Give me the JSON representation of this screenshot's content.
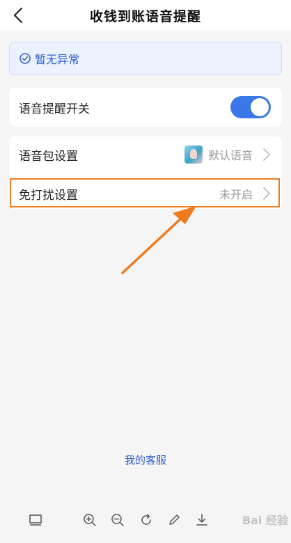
{
  "header": {
    "title": "收钱到账语音提醒"
  },
  "status": {
    "text": "暂无异常"
  },
  "voice_switch": {
    "label": "语音提醒开关",
    "on": true
  },
  "voice_pack": {
    "label": "语音包设置",
    "value": "默认语音"
  },
  "dnd": {
    "label": "免打扰设置",
    "value": "未开启"
  },
  "footer": {
    "service_link": "我的客服"
  },
  "toolbar": {
    "watermark": "Bai 经验"
  },
  "colors": {
    "accent": "#3a78e8",
    "link": "#2f5fcf",
    "annotation": "#f07b1f",
    "background": "#f5f5f5"
  },
  "icons": [
    "back-icon",
    "check-circle-icon",
    "chevron-right-icon",
    "voice-avatar-icon",
    "zoom-in-icon",
    "zoom-out-icon",
    "rotate-icon",
    "edit-icon",
    "download-icon",
    "fit-screen-icon"
  ]
}
